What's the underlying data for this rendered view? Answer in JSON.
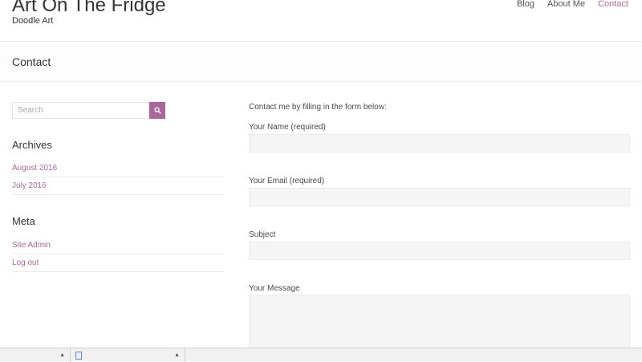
{
  "header": {
    "site_title": "Art On The Fridge",
    "site_description": "Doodle Art",
    "nav": [
      {
        "label": "Blog"
      },
      {
        "label": "About Me"
      },
      {
        "label": "Contact"
      }
    ],
    "active_nav": "Contact"
  },
  "page": {
    "title": "Contact"
  },
  "sidebar": {
    "search": {
      "placeholder": "Search",
      "icon": "search-icon"
    },
    "archives": {
      "title": "Archives",
      "items": [
        {
          "label": "August 2016"
        },
        {
          "label": "July 2016"
        }
      ]
    },
    "meta": {
      "title": "Meta",
      "items": [
        {
          "label": "Site Admin"
        },
        {
          "label": "Log out"
        }
      ]
    }
  },
  "form": {
    "intro": "Contact me by filling in the form below:",
    "name_label": "Your Name (required)",
    "email_label": "Your Email (required)",
    "subject_label": "Subject",
    "message_label": "Your Message"
  },
  "colors": {
    "accent": "#a8699a",
    "field_bg": "#f5f5f5"
  }
}
